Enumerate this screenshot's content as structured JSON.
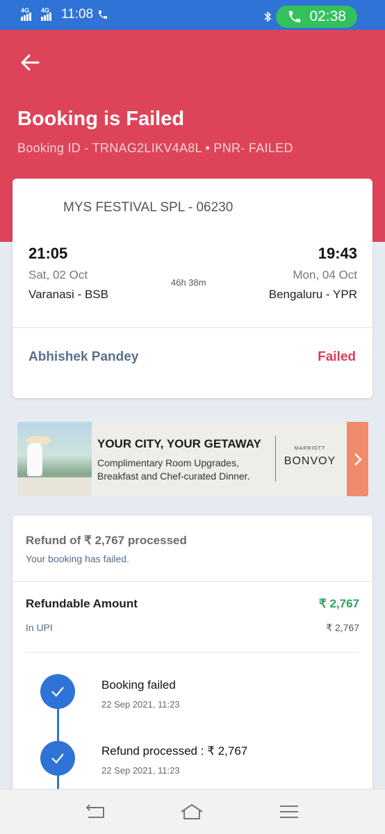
{
  "status_bar": {
    "net1": "4G",
    "net2": "4G",
    "time": "11:08",
    "call_timer": "02:38"
  },
  "header": {
    "title": "Booking is Failed",
    "subtitle": "Booking ID - TRNAG2LIKV4A8L • PNR- FAILED"
  },
  "train": {
    "name": "MYS FESTIVAL SPL - 06230",
    "departure_time": "21:05",
    "departure_date": "Sat, 02 Oct",
    "departure_station": "Varanasi - BSB",
    "arrival_time": "19:43",
    "arrival_date": "Mon, 04 Oct",
    "arrival_station": "Bengaluru - YPR",
    "duration": "46h 38m",
    "passenger_name": "Abhishek Pandey",
    "passenger_status": "Failed"
  },
  "ad": {
    "headline": "YOUR CITY, YOUR GETAWAY",
    "line1": "Complimentary Room Upgrades,",
    "line2": "Breakfast and Chef-curated Dinner.",
    "brand_top": "MARRIOTT",
    "brand_name": "BONVOY"
  },
  "refund": {
    "title": "Refund of ₹ 2,767 processed",
    "subtitle": "Your booking has failed.",
    "refundable_label": "Refundable Amount",
    "refundable_value": "₹ 2,767",
    "method_label": "In UPI",
    "method_value": "₹ 2,767",
    "timeline": [
      {
        "title": "Booking failed",
        "time": "22 Sep 2021, 11:23"
      },
      {
        "title": "Refund processed : ₹ 2,767",
        "time": "22 Sep 2021, 11:23"
      }
    ]
  },
  "colors": {
    "header_bg": "#dd4459",
    "accent_blue": "#2f73d6",
    "success_green": "#2aa55a",
    "failed_red": "#dd3f55"
  },
  "icons": {
    "back": "arrow-left",
    "check": "checkmark",
    "nav_back": "return-arrow",
    "nav_home": "home",
    "nav_menu": "hamburger"
  }
}
